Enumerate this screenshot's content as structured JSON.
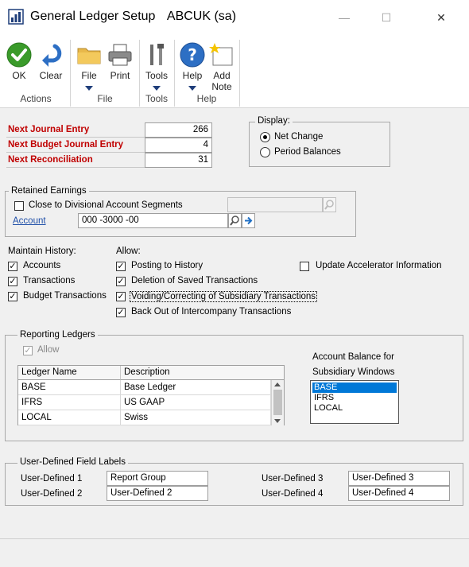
{
  "window": {
    "title": "General Ledger Setup",
    "company": "ABCUK (sa)",
    "minimize": "—",
    "maximize": "☐",
    "close": "✕"
  },
  "ribbon": {
    "ok": "OK",
    "clear": "Clear",
    "file": "File",
    "print": "Print",
    "tools": "Tools",
    "help": "Help",
    "add_note_1": "Add",
    "add_note_2": "Note",
    "groups": {
      "actions": "Actions",
      "file": "File",
      "tools": "Tools",
      "help": "Help"
    }
  },
  "next_numbers": {
    "journal_label": "Next Journal Entry",
    "journal_value": "266",
    "budget_label": "Next Budget Journal Entry",
    "budget_value": "4",
    "reconciliation_label": "Next Reconciliation",
    "reconciliation_value": "31"
  },
  "display": {
    "legend": "Display:",
    "net_change": "Net Change",
    "period_balances": "Period Balances",
    "selected": "Net Change"
  },
  "retained_earnings": {
    "legend": "Retained Earnings",
    "close_divisional": "Close to Divisional Account Segments",
    "account_label": "Account",
    "account_value": "000 -3000 -00"
  },
  "maintain_history": {
    "legend": "Maintain History:",
    "accounts": "Accounts",
    "transactions": "Transactions",
    "budget_transactions": "Budget Transactions"
  },
  "allow": {
    "legend": "Allow:",
    "posting_to_history": "Posting to History",
    "deletion_saved": "Deletion of Saved Transactions",
    "voiding_correcting": "Voiding/Correcting of Subsidiary Transactions",
    "back_out_intercompany": "Back Out of Intercompany Transactions",
    "update_accelerator": "Update Accelerator Information"
  },
  "reporting_ledgers": {
    "legend": "Reporting Ledgers",
    "allow": "Allow",
    "columns": [
      "Ledger Name",
      "Description"
    ],
    "rows": [
      {
        "name": "BASE",
        "description": "Base Ledger"
      },
      {
        "name": "IFRS",
        "description": "US GAAP"
      },
      {
        "name": "LOCAL",
        "description": "Swiss"
      }
    ],
    "balance_label_1": "Account Balance for",
    "balance_label_2": "Subsidiary Windows",
    "balance_items": [
      "BASE",
      "IFRS",
      "LOCAL"
    ],
    "balance_selected": "BASE"
  },
  "user_defined": {
    "legend": "User-Defined Field Labels",
    "ud1_label": "User-Defined 1",
    "ud1_value": "Report Group",
    "ud2_label": "User-Defined 2",
    "ud2_value": "User-Defined 2",
    "ud3_label": "User-Defined 3",
    "ud3_value": "User-Defined 3",
    "ud4_label": "User-Defined 4",
    "ud4_value": "User-Defined 4"
  },
  "colors": {
    "accent": "#0078d7",
    "required_label": "#c00000",
    "ok_green": "#3a9b2a"
  }
}
